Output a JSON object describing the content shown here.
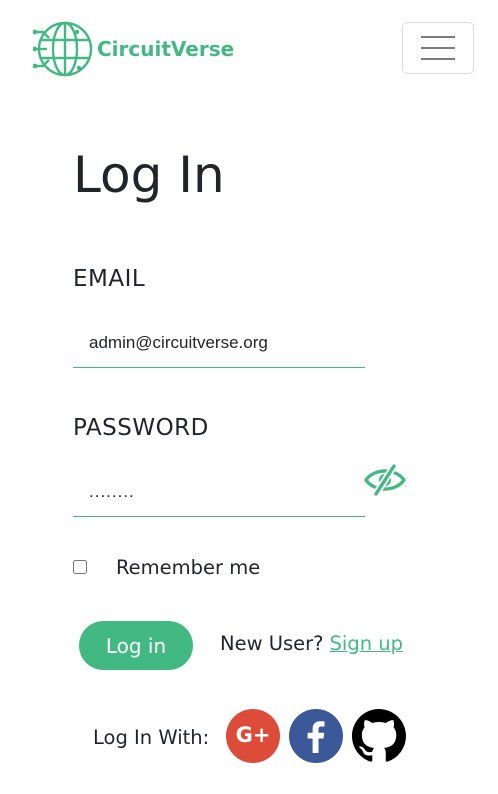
{
  "brand": {
    "name": "CircuitVerse",
    "color": "#42b983"
  },
  "navbar": {
    "menu_icon": "hamburger-menu-icon"
  },
  "page": {
    "title": "Log In"
  },
  "form": {
    "email": {
      "label": "EMAIL",
      "value": "admin@circuitverse.org"
    },
    "password": {
      "label": "PASSWORD",
      "masked_value": "........",
      "toggle_icon": "eye-slash-icon"
    },
    "remember": {
      "label": "Remember me",
      "checked": false
    },
    "submit_label": "Log in",
    "new_user_text": "New User?",
    "signup_label": "Sign up"
  },
  "social": {
    "label": "Log In With:",
    "google_text": "G+",
    "providers": [
      {
        "name": "Google+",
        "icon": "google-plus-icon",
        "color": "#dd4b39"
      },
      {
        "name": "Facebook",
        "icon": "facebook-icon",
        "color": "#3b5998"
      },
      {
        "name": "GitHub",
        "icon": "github-icon",
        "color": "#000000"
      }
    ]
  }
}
